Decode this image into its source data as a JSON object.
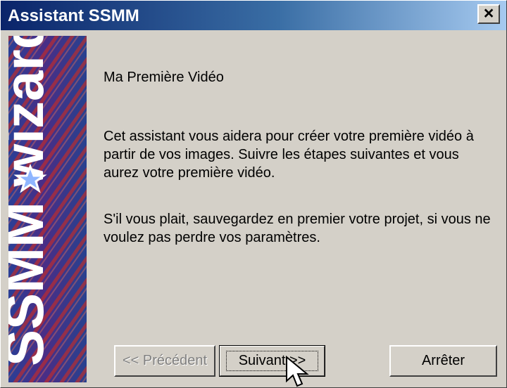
{
  "window": {
    "title": "Assistant SSMM",
    "close_icon": "close-icon"
  },
  "side_art": {
    "logo_text": "SSMM wizard",
    "star_icon": "star-icon"
  },
  "content": {
    "heading": "Ma Première Vidéo",
    "paragraph_1": "Cet assistant vous aidera pour créer votre première vidéo à partir de vos images. Suivre les étapes suivantes et vous aurez votre première vidéo.",
    "paragraph_2": "S'il vous plait, sauvegardez en premier votre projet, si vous ne voulez pas perdre vos paramètres."
  },
  "buttons": {
    "previous": "<< Précédent",
    "next": "Suivant >>",
    "stop": "Arrêter"
  },
  "cursor": {
    "icon": "mouse-pointer-icon"
  }
}
